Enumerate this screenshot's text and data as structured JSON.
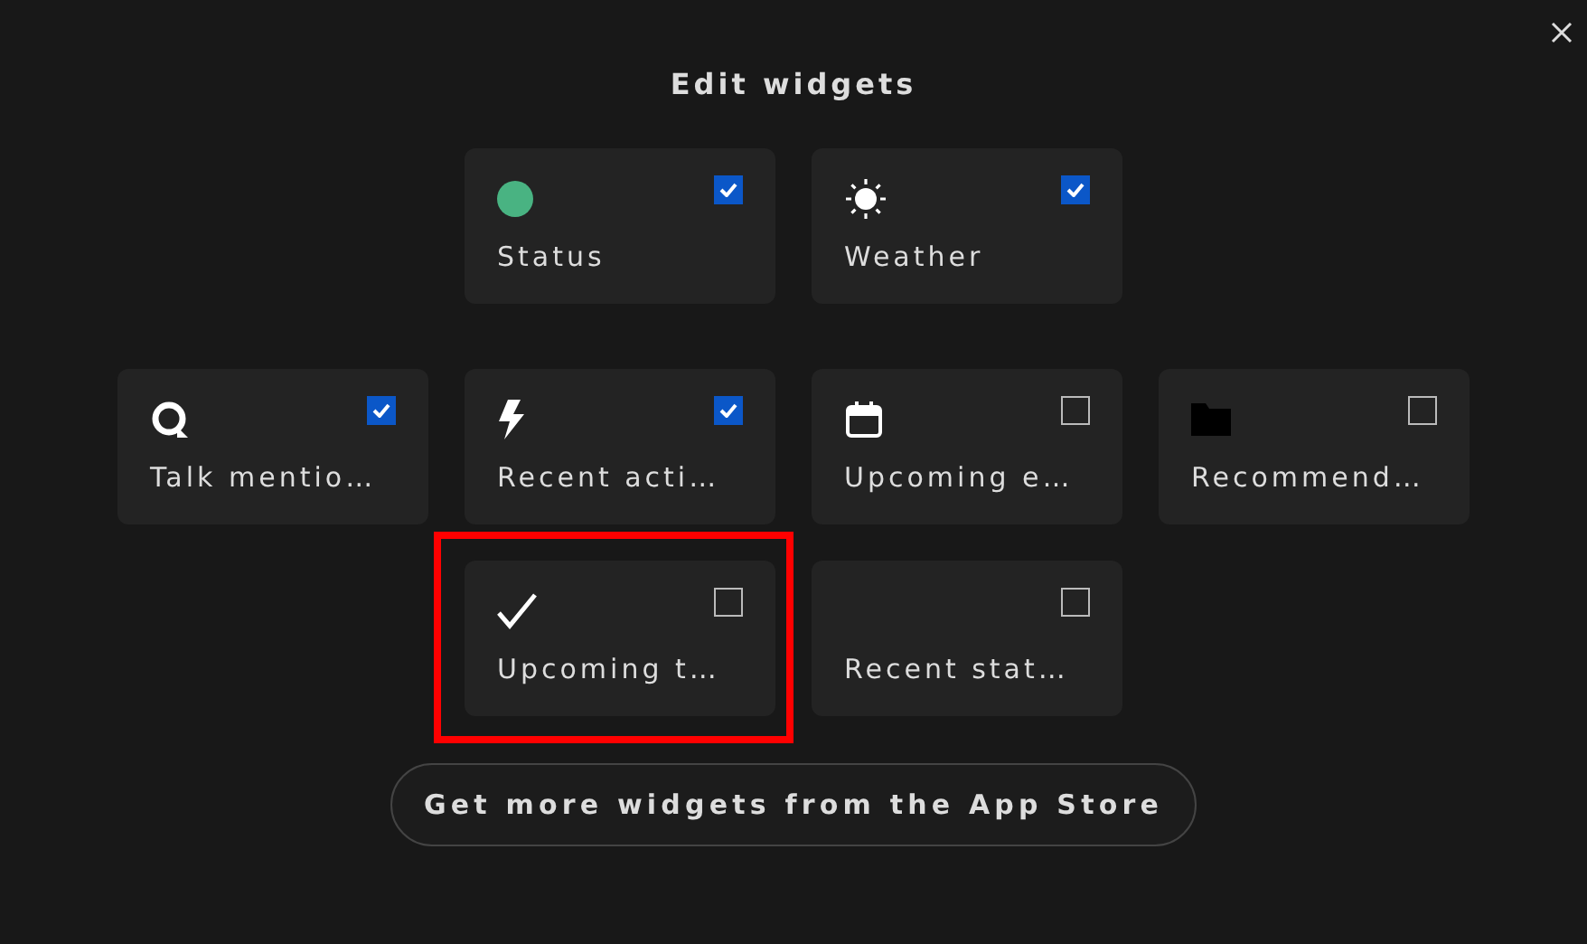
{
  "title": "Edit widgets",
  "rows": [
    {
      "widgets": [
        {
          "kind": "status",
          "label": "Status",
          "checked": true,
          "highlighted": false
        },
        {
          "kind": "weather",
          "label": "Weather",
          "checked": true,
          "highlighted": false
        }
      ]
    },
    {
      "widgets": [
        {
          "kind": "talk",
          "label": "Talk mentio…",
          "checked": true,
          "highlighted": false
        },
        {
          "kind": "activity",
          "label": "Recent acti…",
          "checked": true,
          "highlighted": false
        },
        {
          "kind": "calendar",
          "label": "Upcoming e…",
          "checked": false,
          "highlighted": false
        },
        {
          "kind": "files",
          "label": "Recommend…",
          "checked": false,
          "highlighted": false
        }
      ]
    },
    {
      "widgets": [
        {
          "kind": "tasks",
          "label": "Upcoming t…",
          "checked": false,
          "highlighted": true
        },
        {
          "kind": "none",
          "label": "Recent stat…",
          "checked": false,
          "highlighted": false
        }
      ]
    }
  ],
  "store_button": "Get more widgets from the App Store"
}
